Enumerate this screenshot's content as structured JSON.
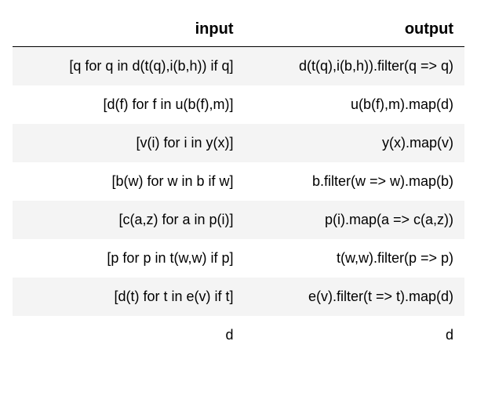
{
  "headers": {
    "input": "input",
    "output": "output"
  },
  "rows": [
    {
      "input": "[q for q in d(t(q),i(b,h)) if q]",
      "output": "d(t(q),i(b,h)).filter(q => q)"
    },
    {
      "input": "[d(f) for f in u(b(f),m)]",
      "output": "u(b(f),m).map(d)"
    },
    {
      "input": "[v(i) for i in y(x)]",
      "output": "y(x).map(v)"
    },
    {
      "input": "[b(w) for w in b if w]",
      "output": "b.filter(w => w).map(b)"
    },
    {
      "input": "[c(a,z) for a in p(i)]",
      "output": "p(i).map(a => c(a,z))"
    },
    {
      "input": "[p for p in t(w,w) if p]",
      "output": "t(w,w).filter(p => p)"
    },
    {
      "input": "[d(t) for t in e(v) if t]",
      "output": "e(v).filter(t => t).map(d)"
    },
    {
      "input": "d",
      "output": "d"
    }
  ]
}
